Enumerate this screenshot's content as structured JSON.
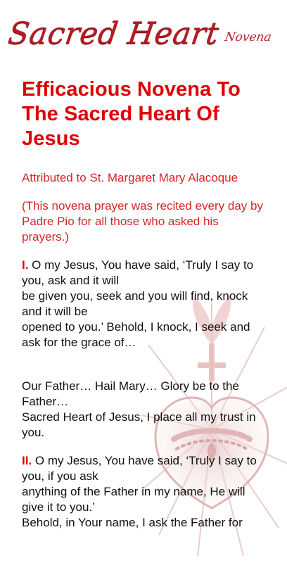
{
  "header": {
    "logo_main": "Sacred Heart",
    "logo_sub": "Novena"
  },
  "content": {
    "title": "Efficacious Novena To The Sacred Heart Of Jesus",
    "attribution": "Attributed to St. Margaret Mary Alacoque",
    "note": "(This novena prayer was recited every day by Padre Pio for all those who asked his prayers.)",
    "section_1": {
      "number": "I.",
      "line_1": " O my Jesus, You have said, ‘Truly I say to you, ask and it will",
      "line_2": "be given you, seek and you will find, knock and it will be",
      "line_3": "opened to you.’ Behold, I knock, I seek and ask for the grace of…"
    },
    "refrain": {
      "line_1": "Our Father… Hail Mary… Glory be to the Father…",
      "line_2": "Sacred Heart of Jesus, I place all my trust in you."
    },
    "section_2": {
      "number": "II.",
      "line_1": " O my Jesus, You have said, ‘Truly I say to you, if you ask",
      "line_2": "anything of the Father in my name, He will give it to you.’",
      "line_3": "Behold, in Your name, I ask the Father for"
    }
  },
  "decor": {
    "watermark_icon": "sacred-heart-icon",
    "accent_color": "#e00000",
    "text_color": "#111111",
    "watermark_color": "#c97b7b"
  }
}
